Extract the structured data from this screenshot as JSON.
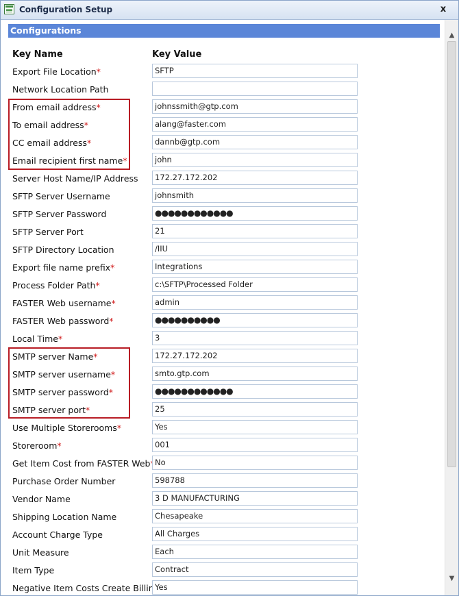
{
  "window": {
    "title": "Configuration Setup",
    "close_label": "x"
  },
  "section": {
    "title": "Configurations"
  },
  "columns": {
    "key": "Key Name",
    "value": "Key Value"
  },
  "rows": [
    {
      "label": "Export File Location",
      "required": true,
      "value": "SFTP"
    },
    {
      "label": "Network Location Path",
      "required": false,
      "value": ""
    },
    {
      "label": "From email address",
      "required": true,
      "value": "johnssmith@gtp.com"
    },
    {
      "label": "To email address",
      "required": true,
      "value": "alang@faster.com"
    },
    {
      "label": "CC email address",
      "required": true,
      "value": "dannb@gtp.com"
    },
    {
      "label": "Email recipient first name",
      "required": true,
      "value": "john"
    },
    {
      "label": "Server Host Name/IP Address",
      "required": false,
      "value": "172.27.172.202"
    },
    {
      "label": "SFTP Server Username",
      "required": false,
      "value": "johnsmith"
    },
    {
      "label": "SFTP Server Password",
      "required": false,
      "value": "●●●●●●●●●●●●",
      "masked": true
    },
    {
      "label": "SFTP Server Port",
      "required": false,
      "value": "21"
    },
    {
      "label": "SFTP Directory Location",
      "required": false,
      "value": "/IIU"
    },
    {
      "label": "Export file name prefix",
      "required": true,
      "value": "Integrations"
    },
    {
      "label": "Process Folder Path",
      "required": true,
      "value": "c:\\SFTP\\Processed Folder"
    },
    {
      "label": "FASTER Web username",
      "required": true,
      "value": "admin"
    },
    {
      "label": "FASTER Web password",
      "required": true,
      "value": "●●●●●●●●●●",
      "masked": true
    },
    {
      "label": "Local Time",
      "required": true,
      "value": "3"
    },
    {
      "label": "SMTP server Name",
      "required": true,
      "value": "172.27.172.202"
    },
    {
      "label": "SMTP server username",
      "required": true,
      "value": "smto.gtp.com"
    },
    {
      "label": "SMTP server password",
      "required": true,
      "value": "●●●●●●●●●●●●",
      "masked": true
    },
    {
      "label": "SMTP server port",
      "required": true,
      "value": "25"
    },
    {
      "label": "Use Multiple Storerooms",
      "required": true,
      "value": "Yes"
    },
    {
      "label": "Storeroom",
      "required": true,
      "value": "001"
    },
    {
      "label": "Get Item Cost from FASTER Web",
      "required": true,
      "value": "No"
    },
    {
      "label": "Purchase Order Number",
      "required": false,
      "value": "598788"
    },
    {
      "label": "Vendor Name",
      "required": false,
      "value": "3 D MANUFACTURING"
    },
    {
      "label": "Shipping Location Name",
      "required": false,
      "value": "Chesapeake"
    },
    {
      "label": "Account Charge Type",
      "required": false,
      "value": "All Charges"
    },
    {
      "label": "Unit Measure",
      "required": false,
      "value": "Each"
    },
    {
      "label": "Item Type",
      "required": false,
      "value": "Contract"
    },
    {
      "label": "Negative Item Costs Create Billing",
      "required": false,
      "value": "Yes"
    }
  ],
  "required_marker": "*",
  "highlight_color": "#b81c24",
  "header_color": "#5b86d8",
  "scroll_up_icon": "chevron-up-icon",
  "scroll_down_icon": "chevron-down-icon"
}
